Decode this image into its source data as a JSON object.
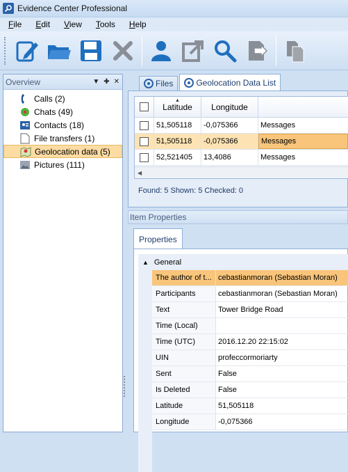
{
  "window": {
    "title": "Evidence Center Professional"
  },
  "menu": [
    {
      "label": "File",
      "ul": "F",
      "rest": "ile"
    },
    {
      "label": "Edit",
      "ul": "E",
      "rest": "dit"
    },
    {
      "label": "View",
      "ul": "V",
      "rest": "iew"
    },
    {
      "label": "Tools",
      "ul": "T",
      "rest": "ools"
    },
    {
      "label": "Help",
      "ul": "H",
      "rest": "elp"
    }
  ],
  "toolbar": {
    "buttons": [
      "edit-icon",
      "open-folder-icon",
      "save-icon",
      "delete-icon",
      "user-icon",
      "export-icon",
      "search-icon",
      "forward-icon",
      "copy-icon"
    ]
  },
  "overview": {
    "title": "Overview",
    "items": [
      {
        "label": "Calls (2)",
        "icon": "phone-icon"
      },
      {
        "label": "Chats (49)",
        "icon": "chat-icon"
      },
      {
        "label": "Contacts (18)",
        "icon": "contact-card-icon"
      },
      {
        "label": "File transfers (1)",
        "icon": "file-icon"
      },
      {
        "label": "Geolocation data (5)",
        "icon": "map-icon",
        "selected": true
      },
      {
        "label": "Pictures (111)",
        "icon": "picture-icon"
      }
    ]
  },
  "tabs": [
    {
      "label": "Files",
      "active": false
    },
    {
      "label": "Geolocation Data List",
      "active": true
    }
  ],
  "grid": {
    "columns": [
      "Latitude",
      "Longitude"
    ],
    "rows": [
      {
        "lat": "51,505118",
        "lon": "-0,075366",
        "msg": "Messages",
        "selected": false
      },
      {
        "lat": "51,505118",
        "lon": "-0,075366",
        "msg": "Messages",
        "selected": true
      },
      {
        "lat": "52,521405",
        "lon": "13,4086",
        "msg": "Messages",
        "selected": false
      }
    ],
    "status": "Found: 5  Shown: 5  Checked: 0"
  },
  "item_properties": {
    "title": "Item Properties",
    "tab": "Properties",
    "category": "General",
    "rows": [
      {
        "name": "The author of t...",
        "value": "cebastianmoran (Sebastian Moran)",
        "selected": true
      },
      {
        "name": "Participants",
        "value": "cebastianmoran (Sebastian Moran)"
      },
      {
        "name": "Text",
        "value": "Tower Bridge Road"
      },
      {
        "name": "Time (Local)",
        "value": ""
      },
      {
        "name": "Time (UTC)",
        "value": "2016.12.20 22:15:02"
      },
      {
        "name": "UIN",
        "value": "profeccormoriarty"
      },
      {
        "name": "Sent",
        "value": "False"
      },
      {
        "name": "Is Deleted",
        "value": "False"
      },
      {
        "name": "Latitude",
        "value": "51,505118"
      },
      {
        "name": "Longitude",
        "value": "-0,075366"
      }
    ]
  },
  "colors": {
    "selection": "#f9c57b",
    "frame": "#cfe0f3",
    "accent": "#2a62a8"
  }
}
